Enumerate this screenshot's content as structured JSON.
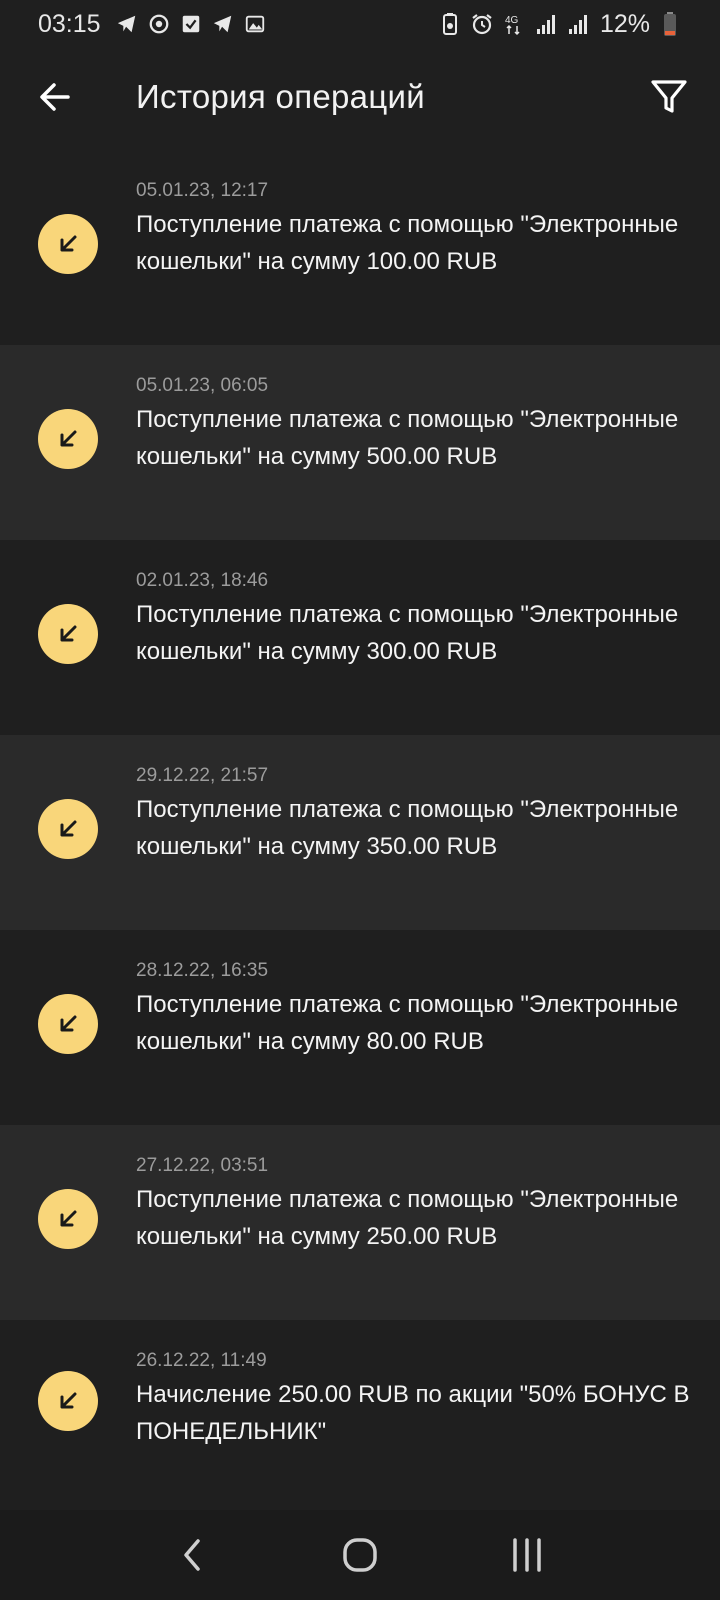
{
  "status_bar": {
    "time": "03:15",
    "left_icons": [
      "telegram-icon",
      "sync-icon",
      "checkbox-icon",
      "telegram-icon",
      "gallery-icon"
    ],
    "right_icons": [
      "battery-saver-icon",
      "alarm-icon",
      "network-4g-icon",
      "signal-icon",
      "signal-icon"
    ],
    "battery": "12%"
  },
  "header": {
    "title": "История операций",
    "back_icon": "arrow-left-icon",
    "filter_icon": "filter-icon"
  },
  "colors": {
    "background": "#1f1f1f",
    "row_alt": "#2a2a2a",
    "icon_circle": "#f9d67a",
    "date_text": "#9c9c9c"
  },
  "transactions": [
    {
      "date": "05.01.23, 12:17",
      "text": "Поступление платежа с помощью \"Электронные кошельки\" на сумму 100.00 RUB",
      "icon": "incoming-arrow-icon"
    },
    {
      "date": "05.01.23, 06:05",
      "text": "Поступление платежа с помощью \"Электронные кошельки\" на сумму 500.00 RUB",
      "icon": "incoming-arrow-icon"
    },
    {
      "date": "02.01.23, 18:46",
      "text": "Поступление платежа с помощью \"Электронные кошельки\" на сумму 300.00 RUB",
      "icon": "incoming-arrow-icon"
    },
    {
      "date": "29.12.22, 21:57",
      "text": "Поступление платежа с помощью \"Электронные кошельки\" на сумму 350.00 RUB",
      "icon": "incoming-arrow-icon"
    },
    {
      "date": "28.12.22, 16:35",
      "text": "Поступление платежа с помощью \"Электронные кошельки\" на сумму 80.00 RUB",
      "icon": "incoming-arrow-icon"
    },
    {
      "date": "27.12.22, 03:51",
      "text": "Поступление платежа с помощью \"Электронные кошельки\" на сумму 250.00 RUB",
      "icon": "incoming-arrow-icon"
    },
    {
      "date": "26.12.22, 11:49",
      "text": "Начисление 250.00 RUB по акции \"50% БОНУС В ПОНЕДЕЛЬНИК\"",
      "icon": "incoming-arrow-icon"
    }
  ],
  "nav_bar": {
    "back": "nav-back-icon",
    "home": "nav-home-icon",
    "recents": "nav-recents-icon"
  }
}
